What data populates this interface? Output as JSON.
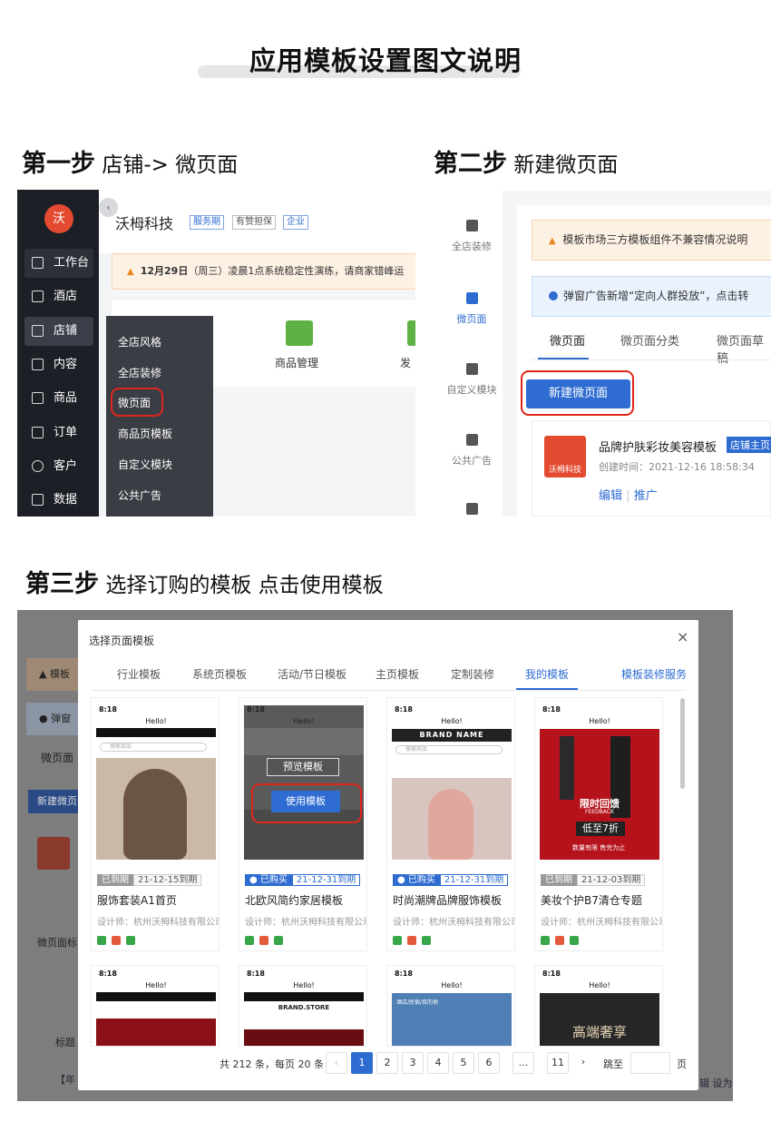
{
  "page_title": "应用模板设置图文说明",
  "step1": {
    "label": "第一步",
    "desc": "店铺-> 微页面"
  },
  "step2": {
    "label": "第二步",
    "desc": "新建微页面"
  },
  "step3": {
    "label": "第三步",
    "desc": "选择订购的模板 点击使用模板"
  },
  "panel1": {
    "logo_text": "沃",
    "nav": [
      "工作台",
      "酒店",
      "店铺",
      "内容",
      "商品",
      "订单",
      "客户",
      "数据"
    ],
    "brand": "沃栂科技",
    "tags": [
      "服务期",
      "有赞担保",
      "企业"
    ],
    "notice_date": "12月29日",
    "notice_rest": "（周三）凌晨1点系统稳定性演练，请商家错峰运",
    "goods_label": "商品管理",
    "fa_label": "发",
    "submenu": [
      "全店风格",
      "全店装修",
      "微页面",
      "商品页模板",
      "自定义模块",
      "公共广告"
    ]
  },
  "panel2": {
    "side": [
      "全店装修",
      "微页面",
      "自定义模块",
      "公共广告"
    ],
    "warn": "模板市场三方模板组件不兼容情况说明",
    "info": "弹窗广告新增“定向人群投放”，点击转",
    "tabs": [
      "微页面",
      "微页面分类",
      "微页面草稿"
    ],
    "new_button": "新建微页面",
    "tpl_logo": "沃栂科技",
    "tpl_name": "品牌护肤彩妆美容模板",
    "tpl_badge": "店铺主页",
    "tpl_time": "创建时间：2021-12-16 18:58:34",
    "tpl_edit": "编辑",
    "tpl_promote": "推广"
  },
  "panel3": {
    "bg_texts": {
      "tag1": "模板",
      "tag2": "弹窗",
      "tab": "微页面",
      "btn": "新建微页",
      "label": "微页面标",
      "col": "标题",
      "row": "【年",
      "right": "辑 设为"
    },
    "modal_title": "选择页面模板",
    "close": "×",
    "tabs": [
      "行业模板",
      "系统页模板",
      "活动/节日模板",
      "主页模板",
      "定制装修",
      "我的模板"
    ],
    "service": "模板装修服务",
    "preview_btn": "预览模板",
    "use_btn": "使用模板",
    "phone_time": "8:18",
    "phone_hello": "Hello!",
    "search_ph": "搜索商品",
    "search_btn": "搜索",
    "cards": [
      {
        "status": "已到期",
        "date": "21-12-15到期",
        "name": "服饰套装A1首页",
        "designer": "设计师：杭州沃栂科技有限公司"
      },
      {
        "status": "已购买",
        "date": "21-12-31到期",
        "name": "北欧风简约家居模板",
        "designer": "设计师：杭州沃栂科技有限公司"
      },
      {
        "status": "已购买",
        "date": "21-12-31到期",
        "name": "时尚潮牌品牌服饰模板",
        "designer": "设计师：杭州沃栂科技有限公司"
      },
      {
        "status": "已到期",
        "date": "21-12-03到期",
        "name": "美妆个护B7清仓专题",
        "designer": "设计师：杭州沃栂科技有限公司"
      }
    ],
    "card3_brand": "BRAND NAME",
    "card4_promo": "限时回馈",
    "card4_feedback": "FEEDBACK",
    "card4_price": "低至7折",
    "card4_sub": "数量有限 售完为止",
    "row2_texts": {
      "c2": "BRAND.STORE",
      "c3": "酒店/民宿/目的地",
      "c4": "高端奢享"
    },
    "pagination": {
      "total": "共 212 条，每页 20 条",
      "pages": [
        "1",
        "2",
        "3",
        "4",
        "5",
        "6",
        "...",
        "11"
      ],
      "jump": "跳至",
      "page_unit": "页"
    }
  }
}
